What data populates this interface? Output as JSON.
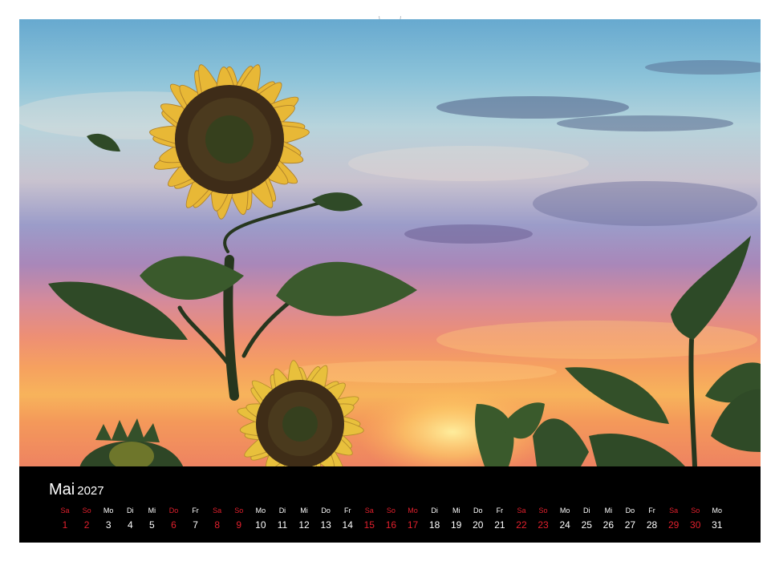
{
  "calendar": {
    "month": "Mai",
    "year": "2027",
    "accent_color": "#e2202d",
    "days": [
      {
        "name": "Sa",
        "num": "1",
        "red": true
      },
      {
        "name": "So",
        "num": "2",
        "red": true
      },
      {
        "name": "Mo",
        "num": "3",
        "red": false
      },
      {
        "name": "Di",
        "num": "4",
        "red": false
      },
      {
        "name": "Mi",
        "num": "5",
        "red": false
      },
      {
        "name": "Do",
        "num": "6",
        "red": true
      },
      {
        "name": "Fr",
        "num": "7",
        "red": false
      },
      {
        "name": "Sa",
        "num": "8",
        "red": true
      },
      {
        "name": "So",
        "num": "9",
        "red": true
      },
      {
        "name": "Mo",
        "num": "10",
        "red": false
      },
      {
        "name": "Di",
        "num": "11",
        "red": false
      },
      {
        "name": "Mi",
        "num": "12",
        "red": false
      },
      {
        "name": "Do",
        "num": "13",
        "red": false
      },
      {
        "name": "Fr",
        "num": "14",
        "red": false
      },
      {
        "name": "Sa",
        "num": "15",
        "red": true
      },
      {
        "name": "So",
        "num": "16",
        "red": true
      },
      {
        "name": "Mo",
        "num": "17",
        "red": true
      },
      {
        "name": "Di",
        "num": "18",
        "red": false
      },
      {
        "name": "Mi",
        "num": "19",
        "red": false
      },
      {
        "name": "Do",
        "num": "20",
        "red": false
      },
      {
        "name": "Fr",
        "num": "21",
        "red": false
      },
      {
        "name": "Sa",
        "num": "22",
        "red": true
      },
      {
        "name": "So",
        "num": "23",
        "red": true
      },
      {
        "name": "Mo",
        "num": "24",
        "red": false
      },
      {
        "name": "Di",
        "num": "25",
        "red": false
      },
      {
        "name": "Mi",
        "num": "26",
        "red": false
      },
      {
        "name": "Do",
        "num": "27",
        "red": false
      },
      {
        "name": "Fr",
        "num": "28",
        "red": false
      },
      {
        "name": "Sa",
        "num": "29",
        "red": true
      },
      {
        "name": "So",
        "num": "30",
        "red": true
      },
      {
        "name": "Mo",
        "num": "31",
        "red": false
      }
    ]
  },
  "photo": {
    "subject": "sunflower-silhouettes-at-sunset"
  }
}
